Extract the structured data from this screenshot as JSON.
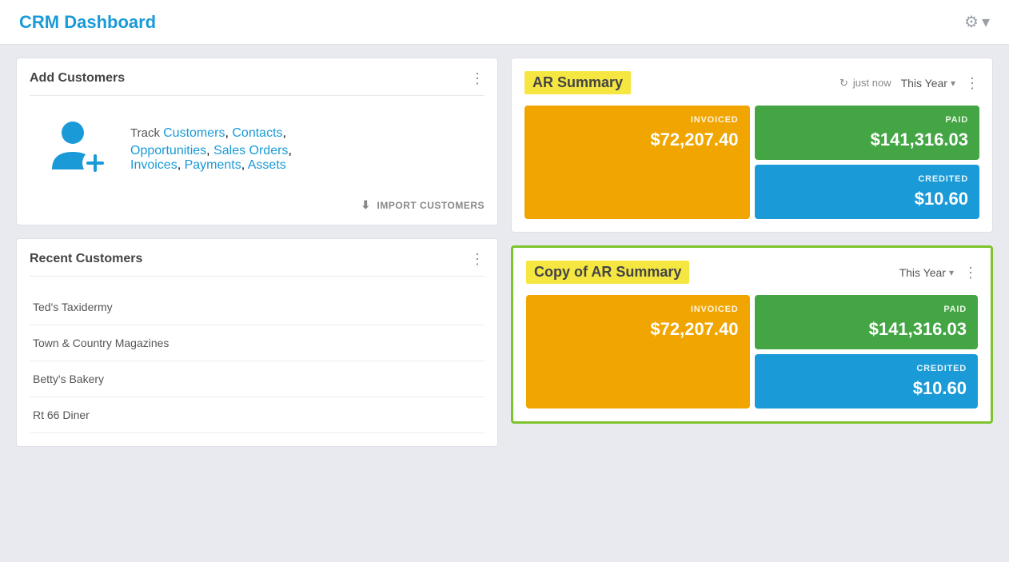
{
  "header": {
    "title": "CRM Dashboard",
    "gear_label": "⚙",
    "dropdown_arrow": "▾"
  },
  "add_customers": {
    "title": "Add Customers",
    "track_prefix": "Track ",
    "links": [
      "Customers",
      "Contacts",
      "Opportunities",
      "Sales Orders",
      "Invoices",
      "Payments",
      "Assets"
    ],
    "import_label": "IMPORT CUSTOMERS",
    "more_icon": "⋮"
  },
  "recent_customers": {
    "title": "Recent Customers",
    "more_icon": "⋮",
    "customers": [
      {
        "name": "Ted's Taxidermy"
      },
      {
        "name": "Town & Country Magazines"
      },
      {
        "name": "Betty's Bakery"
      },
      {
        "name": "Rt 66 Diner"
      }
    ]
  },
  "ar_summary": {
    "title": "AR Summary",
    "refresh_icon": "↻",
    "refresh_time": "just now",
    "period": "This Year",
    "more_icon": "⋮",
    "chevron": "▾",
    "invoiced_label": "INVOICED",
    "invoiced_value": "$72,207.40",
    "paid_label": "PAID",
    "paid_value": "$141,316.03",
    "credited_label": "CREDITED",
    "credited_value": "$10.60"
  },
  "ar_summary_copy": {
    "title": "Copy of AR Summary",
    "period": "This Year",
    "more_icon": "⋮",
    "chevron": "▾",
    "invoiced_label": "INVOICED",
    "invoiced_value": "$72,207.40",
    "paid_label": "PAID",
    "paid_value": "$141,316.03",
    "credited_label": "CREDITED",
    "credited_value": "$10.60"
  }
}
